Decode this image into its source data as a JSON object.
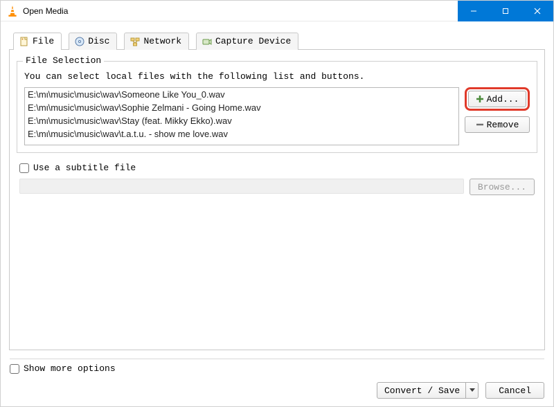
{
  "window": {
    "title": "Open Media",
    "icon_name": "vlc-cone-icon"
  },
  "tabs": [
    {
      "label": "File",
      "icon": "file-icon"
    },
    {
      "label": "Disc",
      "icon": "disc-icon"
    },
    {
      "label": "Network",
      "icon": "network-icon"
    },
    {
      "label": "Capture Device",
      "icon": "capture-icon"
    }
  ],
  "file_selection": {
    "group_title": "File Selection",
    "help_text": "You can select local files with the following list and buttons.",
    "files": [
      "E:\\mι\\music\\music\\wav\\Someone Like You_0.wav",
      "E:\\mι\\music\\music\\wav\\Sophie Zelmani - Going Home.wav",
      "E:\\mι\\music\\music\\wav\\Stay (feat. Mikky Ekko).wav",
      "E:\\mι\\music\\music\\wav\\t.a.t.u. - show me love.wav"
    ],
    "add_label": "Add...",
    "remove_label": "Remove"
  },
  "subtitle": {
    "checkbox_label": "Use a subtitle file",
    "browse_label": "Browse..."
  },
  "footer": {
    "show_more_label": "Show more options",
    "convert_label": "Convert / Save",
    "cancel_label": "Cancel"
  }
}
